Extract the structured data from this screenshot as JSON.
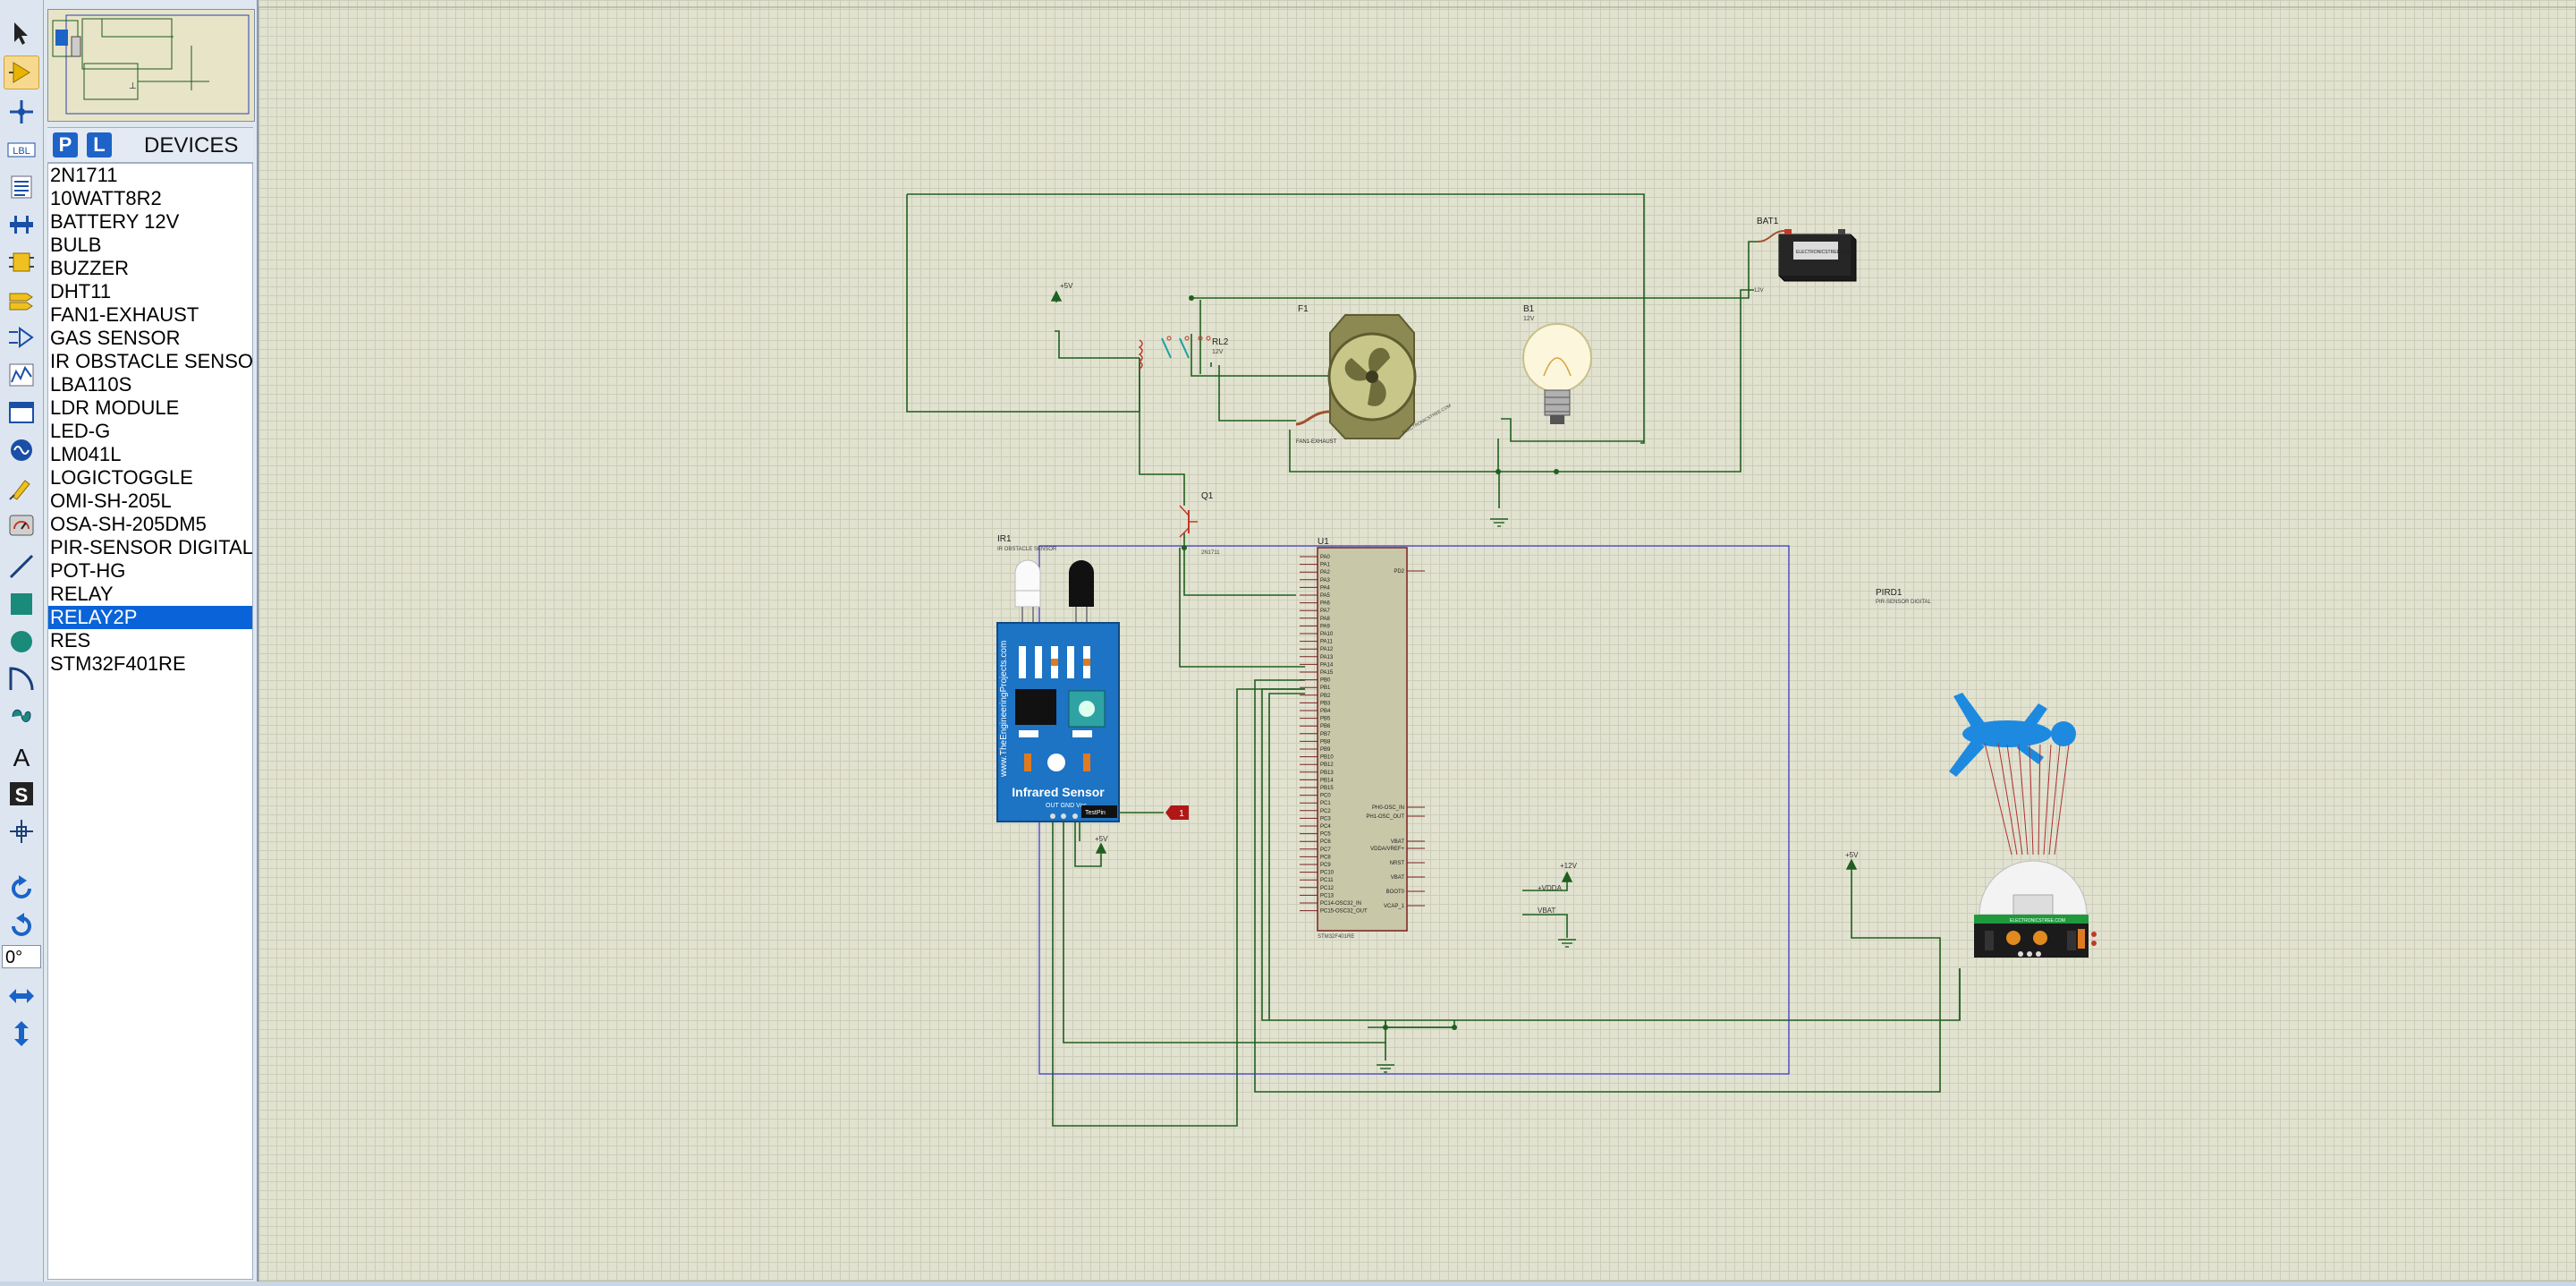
{
  "devices_panel": {
    "p_label": "P",
    "l_label": "L",
    "title": "DEVICES",
    "items": [
      "2N1711",
      "10WATT8R2",
      "BATTERY 12V",
      "BULB",
      "BUZZER",
      "DHT11",
      "FAN1-EXHAUST",
      "GAS SENSOR",
      "IR OBSTACLE SENSO",
      "LBA110S",
      "LDR MODULE",
      "LED-G",
      "LM041L",
      "LOGICTOGGLE",
      "OMI-SH-205L",
      "OSA-SH-205DM5",
      "PIR-SENSOR DIGITAL",
      "POT-HG",
      "RELAY",
      "RELAY2P",
      "RES",
      "STM32F401RE"
    ],
    "selected": "RELAY2P"
  },
  "toolbar": {
    "lbl_label": "LBL",
    "text_tool_label": "A",
    "script_tool_label": "S",
    "rotation_value": "0°"
  },
  "schematic": {
    "ir_sensor": {
      "ref": "IR1",
      "type": "IR OBSTACLE SENSOR",
      "brand": "www.TheEngineeringProjects.com",
      "label": "Infrared Sensor",
      "pins": "OUT GND Vcc",
      "testpin": "TestPin"
    },
    "logic_probe": "1",
    "relay": {
      "ref": "RL2",
      "value": "12V"
    },
    "fan": {
      "ref": "F1",
      "type": "FAN1-EXHAUST",
      "brand": "ELECTRONICSTREE.COM"
    },
    "bulb": {
      "ref": "B1",
      "value": "12V"
    },
    "battery": {
      "ref": "BAT1",
      "value": "12V",
      "brand": "ELECTRONICSTREE.COM"
    },
    "transistor": {
      "ref": "Q1",
      "type": "2N1711"
    },
    "mcu": {
      "ref": "U1",
      "part": "STM32F401RE",
      "left_pins": [
        "PA0",
        "PA1",
        "PA2",
        "PA3",
        "PA4",
        "PA5",
        "PA6",
        "PA7",
        "PA8",
        "PA9",
        "PA10",
        "PA11",
        "PA12",
        "PA13",
        "PA14",
        "PA15",
        "PB0",
        "PB1",
        "PB2",
        "PB3",
        "PB4",
        "PB5",
        "PB6",
        "PB7",
        "PB8",
        "PB9",
        "PB10",
        "PB12",
        "PB13",
        "PB14",
        "PB15",
        "PC0",
        "PC1",
        "PC2",
        "PC3",
        "PC4",
        "PC5",
        "PC6",
        "PC7",
        "PC8",
        "PC9",
        "PC10",
        "PC11",
        "PC12",
        "PC13",
        "PC14-OSC32_IN",
        "PC15-OSC32_OUT"
      ],
      "right_pins": [
        "PD2",
        "PH0-OSC_IN",
        "PH1-OSC_OUT",
        "VBAT",
        "VDDA/VREF+",
        "NRST",
        "VBAT",
        "BOOT0",
        "VCAP_1"
      ]
    },
    "pir": {
      "ref": "PIRD1",
      "type": "PIR-SENSOR DIGITAL",
      "brand": "ELECTRONICSTREE.COM"
    },
    "power_labels": {
      "vcc": "+5V",
      "v12": "+12V",
      "vdda": "+VDDA",
      "vbat": "VBAT"
    }
  }
}
